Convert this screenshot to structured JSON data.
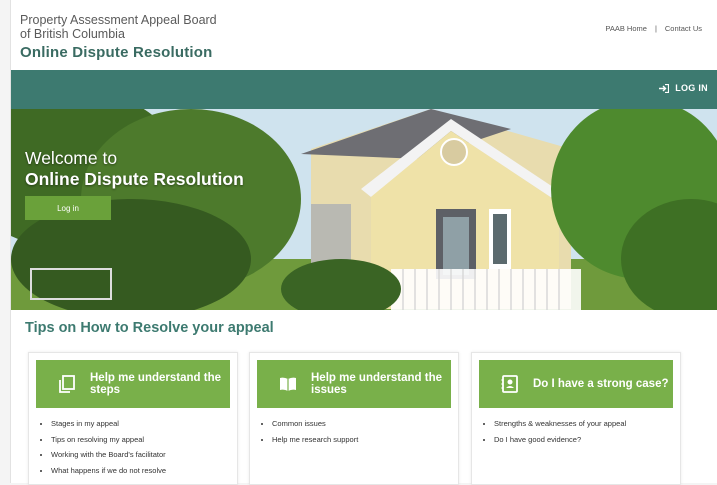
{
  "header": {
    "org_line1": "Property Assessment Appeal Board",
    "org_line2": "of British Columbia",
    "app_title": "Online Dispute Resolution",
    "links": [
      "PAAB Home",
      "Contact Us"
    ],
    "link_separator": "|"
  },
  "nav": {
    "login_label": "LOG IN",
    "login_icon": "sign-in-icon"
  },
  "hero": {
    "welcome_line1": "Welcome to",
    "welcome_line2": "Online Dispute Resolution",
    "button_label": "Log in"
  },
  "tips": {
    "title": "Tips on How to Resolve your appeal",
    "cards": [
      {
        "title": "Help me understand the steps",
        "icon": "document-copy-icon",
        "items": [
          "Stages in my appeal",
          "Tips on resolving my appeal",
          "Working with the Board's facilitator",
          "What happens if we do not resolve"
        ]
      },
      {
        "title": "Help me understand the issues",
        "icon": "open-book-icon",
        "items": [
          "Common issues",
          "Help me research support"
        ]
      },
      {
        "title": "Do I have a strong case?",
        "icon": "contact-card-icon",
        "items": [
          "Strengths & weaknesses of your appeal",
          "Do I have good evidence?"
        ]
      }
    ]
  },
  "colors": {
    "nav": "#3d7a70",
    "accent_green": "#79b04a",
    "heading_teal": "#3d7a70"
  }
}
